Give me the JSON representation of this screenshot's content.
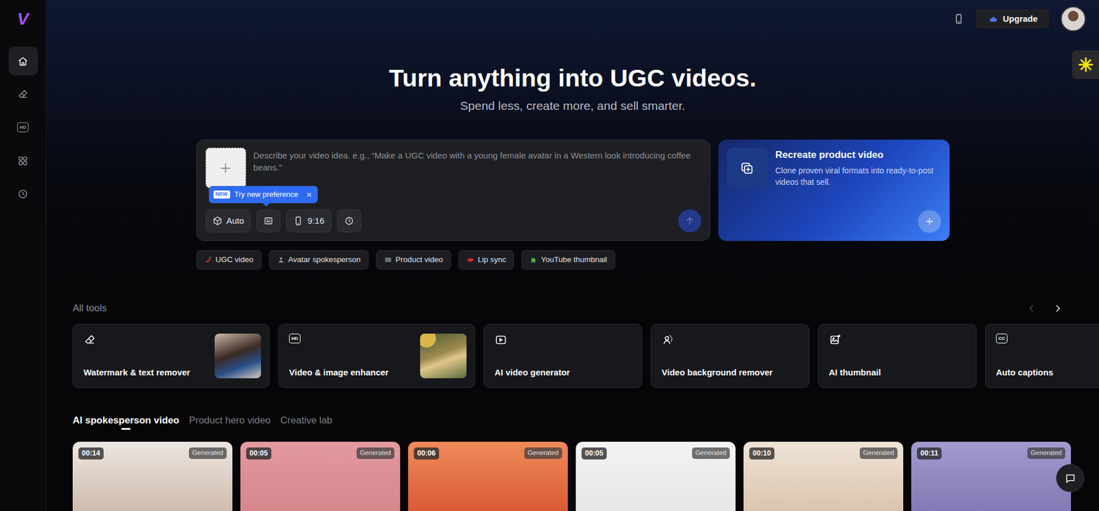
{
  "sidebar": {
    "logo": "V",
    "items": [
      {
        "kind": "home",
        "selected": true
      },
      {
        "kind": "eraser",
        "selected": false
      },
      {
        "kind": "hd",
        "icon_text": "HD",
        "selected": false
      },
      {
        "kind": "apps",
        "selected": false
      },
      {
        "kind": "history",
        "selected": false
      }
    ]
  },
  "topbar": {
    "upgrade": "Upgrade"
  },
  "hero": {
    "title": "Turn anything into UGC videos.",
    "subtitle": "Spend less, create more, and sell smarter."
  },
  "prompt": {
    "placeholder": "Describe your video idea. e.g., “Make a UGC video with a young female avatar in a Western look introducing coffee beans.”",
    "tooltip": {
      "badge": "NEW",
      "text": "Try new preference",
      "close": "×"
    },
    "mode": "Auto",
    "ratio": "9:16",
    "send_disabled": true
  },
  "recreate": {
    "title": "Recreate product video",
    "description": "Clone proven viral formats into ready-to-post videos that sell."
  },
  "chips": [
    {
      "kind": "pepper",
      "label": "UGC video"
    },
    {
      "kind": "person",
      "label": "Avatar spokesperson"
    },
    {
      "kind": "film",
      "label": "Product video"
    },
    {
      "kind": "lips",
      "label": "Lip sync"
    },
    {
      "kind": "puzzle",
      "label": "YouTube thumbnail"
    }
  ],
  "tools": {
    "title": "All tools",
    "prev_disabled": true,
    "next_disabled": false,
    "items": [
      {
        "kind": "eraser",
        "title": "Watermark & text remover",
        "image": true
      },
      {
        "kind": "hd",
        "icon_text": "HD",
        "title": "Video & image enhancer",
        "image": true
      },
      {
        "kind": "play",
        "title": "AI video generator",
        "image": false
      },
      {
        "kind": "person",
        "title": "Video background remover",
        "image": false
      },
      {
        "kind": "image",
        "title": "AI thumbnail",
        "image": false
      },
      {
        "kind": "captions",
        "icon_text": "CC",
        "title": "Auto captions",
        "image": false
      }
    ]
  },
  "gallery": {
    "tabs": [
      {
        "label": "AI spokesperson video",
        "selected": true
      },
      {
        "label": "Product hero video",
        "selected": false
      },
      {
        "label": "Creative lab",
        "selected": false
      }
    ],
    "videos": [
      {
        "duration": "00:14",
        "badge": "Generated"
      },
      {
        "duration": "00:05",
        "badge": "Generated"
      },
      {
        "duration": "00:06",
        "badge": "Generated"
      },
      {
        "duration": "00:05",
        "badge": "Generated"
      },
      {
        "duration": "00:10",
        "badge": "Generated"
      },
      {
        "duration": "00:11",
        "badge": "Generated"
      }
    ]
  }
}
